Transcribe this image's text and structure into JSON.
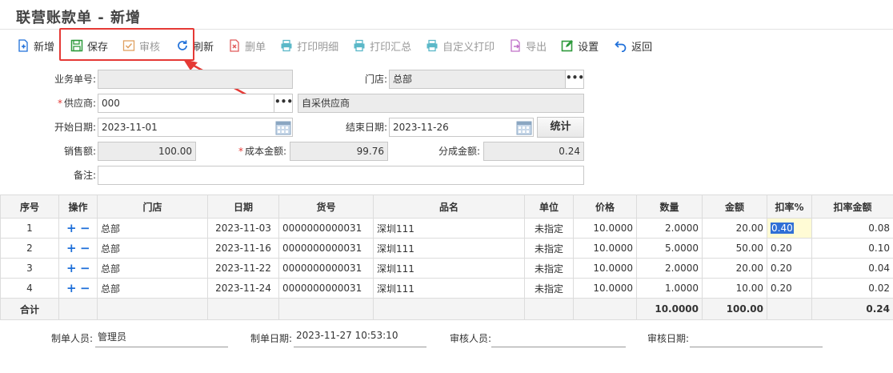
{
  "title": "联营账款单 - 新增",
  "toolbar": [
    {
      "label": "新增",
      "icon": "add-document-icon",
      "color": "#1e6fd9",
      "state": "enabled"
    },
    {
      "label": "保存",
      "icon": "save-icon",
      "color": "#2e9a3c",
      "state": "enabled"
    },
    {
      "label": "审核",
      "icon": "approve-check-icon",
      "color": "#e0a060",
      "state": "disabled"
    },
    {
      "label": "刷新",
      "icon": "refresh-icon",
      "color": "#1e6fd9",
      "state": "enabled"
    },
    {
      "label": "删单",
      "icon": "delete-document-icon",
      "color": "#e05a5a",
      "state": "disabled"
    },
    {
      "label": "打印明细",
      "icon": "printer-icon",
      "color": "#5bb8c8",
      "state": "disabled"
    },
    {
      "label": "打印汇总",
      "icon": "printer-icon",
      "color": "#5bb8c8",
      "state": "disabled"
    },
    {
      "label": "自定义打印",
      "icon": "printer-icon",
      "color": "#5bb8c8",
      "state": "disabled"
    },
    {
      "label": "导出",
      "icon": "export-icon",
      "color": "#c070c8",
      "state": "disabled"
    },
    {
      "label": "设置",
      "icon": "settings-edit-icon",
      "color": "#2e9a3c",
      "state": "enabled"
    },
    {
      "label": "返回",
      "icon": "back-arrow-icon",
      "color": "#1e6fd9",
      "state": "enabled"
    }
  ],
  "form": {
    "business_no_label": "业务单号:",
    "business_no": "",
    "store_label": "门店:",
    "store": "总部",
    "supplier_label": "供应商:",
    "supplier_code": "000",
    "supplier_name": "自采供应商",
    "start_date_label": "开始日期:",
    "start_date": "2023-11-01",
    "end_date_label": "结束日期:",
    "end_date": "2023-11-26",
    "stat_button": "统计",
    "sales_label": "销售额:",
    "sales": "100.00",
    "cost_label": "成本金额:",
    "cost": "99.76",
    "share_label": "分成金额:",
    "share": "0.24",
    "remark_label": "备注:",
    "remark": "",
    "dots": "•••",
    "required_mark": "*"
  },
  "table": {
    "headers": [
      "序号",
      "操作",
      "门店",
      "日期",
      "货号",
      "品名",
      "单位",
      "价格",
      "数量",
      "金额",
      "扣率%",
      "扣率金额"
    ],
    "rows": [
      {
        "no": "1",
        "store": "总部",
        "date": "2023-11-03",
        "sku": "0000000000031",
        "name": "深圳111",
        "unit": "未指定",
        "price": "10.0000",
        "qty": "2.0000",
        "amount": "20.00",
        "rate": "0.40",
        "rate_amount": "0.08"
      },
      {
        "no": "2",
        "store": "总部",
        "date": "2023-11-16",
        "sku": "0000000000031",
        "name": "深圳111",
        "unit": "未指定",
        "price": "10.0000",
        "qty": "5.0000",
        "amount": "50.00",
        "rate": "0.20",
        "rate_amount": "0.10"
      },
      {
        "no": "3",
        "store": "总部",
        "date": "2023-11-22",
        "sku": "0000000000031",
        "name": "深圳111",
        "unit": "未指定",
        "price": "10.0000",
        "qty": "2.0000",
        "amount": "20.00",
        "rate": "0.20",
        "rate_amount": "0.04"
      },
      {
        "no": "4",
        "store": "总部",
        "date": "2023-11-24",
        "sku": "0000000000031",
        "name": "深圳111",
        "unit": "未指定",
        "price": "10.0000",
        "qty": "1.0000",
        "amount": "10.00",
        "rate": "0.20",
        "rate_amount": "0.02"
      }
    ],
    "total": {
      "label": "合计",
      "qty": "10.0000",
      "amount": "100.00",
      "rate_amount": "0.24"
    }
  },
  "footer": {
    "creator_label": "制单人员:",
    "creator": "管理员",
    "create_date_label": "制单日期:",
    "create_date": "2023-11-27 10:53:10",
    "auditor_label": "审核人员:",
    "auditor": "",
    "audit_date_label": "审核日期:",
    "audit_date": ""
  },
  "colors": {
    "accent": "#1e6fd9",
    "highlight": "#e53935",
    "readonly": "#ececec"
  }
}
